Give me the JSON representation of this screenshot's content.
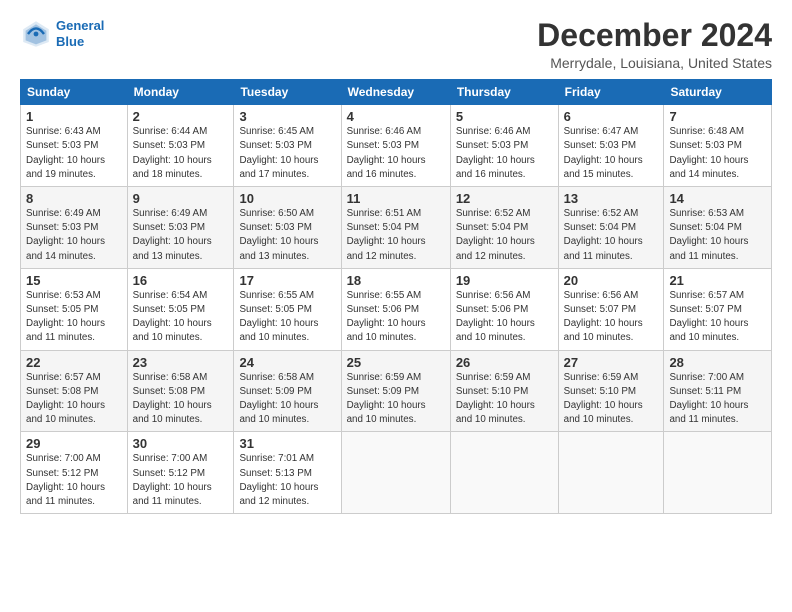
{
  "header": {
    "logo_line1": "General",
    "logo_line2": "Blue",
    "title": "December 2024",
    "subtitle": "Merrydale, Louisiana, United States"
  },
  "weekdays": [
    "Sunday",
    "Monday",
    "Tuesday",
    "Wednesday",
    "Thursday",
    "Friday",
    "Saturday"
  ],
  "weeks": [
    [
      {
        "day": "1",
        "info": "Sunrise: 6:43 AM\nSunset: 5:03 PM\nDaylight: 10 hours\nand 19 minutes."
      },
      {
        "day": "2",
        "info": "Sunrise: 6:44 AM\nSunset: 5:03 PM\nDaylight: 10 hours\nand 18 minutes."
      },
      {
        "day": "3",
        "info": "Sunrise: 6:45 AM\nSunset: 5:03 PM\nDaylight: 10 hours\nand 17 minutes."
      },
      {
        "day": "4",
        "info": "Sunrise: 6:46 AM\nSunset: 5:03 PM\nDaylight: 10 hours\nand 16 minutes."
      },
      {
        "day": "5",
        "info": "Sunrise: 6:46 AM\nSunset: 5:03 PM\nDaylight: 10 hours\nand 16 minutes."
      },
      {
        "day": "6",
        "info": "Sunrise: 6:47 AM\nSunset: 5:03 PM\nDaylight: 10 hours\nand 15 minutes."
      },
      {
        "day": "7",
        "info": "Sunrise: 6:48 AM\nSunset: 5:03 PM\nDaylight: 10 hours\nand 14 minutes."
      }
    ],
    [
      {
        "day": "8",
        "info": "Sunrise: 6:49 AM\nSunset: 5:03 PM\nDaylight: 10 hours\nand 14 minutes."
      },
      {
        "day": "9",
        "info": "Sunrise: 6:49 AM\nSunset: 5:03 PM\nDaylight: 10 hours\nand 13 minutes."
      },
      {
        "day": "10",
        "info": "Sunrise: 6:50 AM\nSunset: 5:03 PM\nDaylight: 10 hours\nand 13 minutes."
      },
      {
        "day": "11",
        "info": "Sunrise: 6:51 AM\nSunset: 5:04 PM\nDaylight: 10 hours\nand 12 minutes."
      },
      {
        "day": "12",
        "info": "Sunrise: 6:52 AM\nSunset: 5:04 PM\nDaylight: 10 hours\nand 12 minutes."
      },
      {
        "day": "13",
        "info": "Sunrise: 6:52 AM\nSunset: 5:04 PM\nDaylight: 10 hours\nand 11 minutes."
      },
      {
        "day": "14",
        "info": "Sunrise: 6:53 AM\nSunset: 5:04 PM\nDaylight: 10 hours\nand 11 minutes."
      }
    ],
    [
      {
        "day": "15",
        "info": "Sunrise: 6:53 AM\nSunset: 5:05 PM\nDaylight: 10 hours\nand 11 minutes."
      },
      {
        "day": "16",
        "info": "Sunrise: 6:54 AM\nSunset: 5:05 PM\nDaylight: 10 hours\nand 10 minutes."
      },
      {
        "day": "17",
        "info": "Sunrise: 6:55 AM\nSunset: 5:05 PM\nDaylight: 10 hours\nand 10 minutes."
      },
      {
        "day": "18",
        "info": "Sunrise: 6:55 AM\nSunset: 5:06 PM\nDaylight: 10 hours\nand 10 minutes."
      },
      {
        "day": "19",
        "info": "Sunrise: 6:56 AM\nSunset: 5:06 PM\nDaylight: 10 hours\nand 10 minutes."
      },
      {
        "day": "20",
        "info": "Sunrise: 6:56 AM\nSunset: 5:07 PM\nDaylight: 10 hours\nand 10 minutes."
      },
      {
        "day": "21",
        "info": "Sunrise: 6:57 AM\nSunset: 5:07 PM\nDaylight: 10 hours\nand 10 minutes."
      }
    ],
    [
      {
        "day": "22",
        "info": "Sunrise: 6:57 AM\nSunset: 5:08 PM\nDaylight: 10 hours\nand 10 minutes."
      },
      {
        "day": "23",
        "info": "Sunrise: 6:58 AM\nSunset: 5:08 PM\nDaylight: 10 hours\nand 10 minutes."
      },
      {
        "day": "24",
        "info": "Sunrise: 6:58 AM\nSunset: 5:09 PM\nDaylight: 10 hours\nand 10 minutes."
      },
      {
        "day": "25",
        "info": "Sunrise: 6:59 AM\nSunset: 5:09 PM\nDaylight: 10 hours\nand 10 minutes."
      },
      {
        "day": "26",
        "info": "Sunrise: 6:59 AM\nSunset: 5:10 PM\nDaylight: 10 hours\nand 10 minutes."
      },
      {
        "day": "27",
        "info": "Sunrise: 6:59 AM\nSunset: 5:10 PM\nDaylight: 10 hours\nand 10 minutes."
      },
      {
        "day": "28",
        "info": "Sunrise: 7:00 AM\nSunset: 5:11 PM\nDaylight: 10 hours\nand 11 minutes."
      }
    ],
    [
      {
        "day": "29",
        "info": "Sunrise: 7:00 AM\nSunset: 5:12 PM\nDaylight: 10 hours\nand 11 minutes."
      },
      {
        "day": "30",
        "info": "Sunrise: 7:00 AM\nSunset: 5:12 PM\nDaylight: 10 hours\nand 11 minutes."
      },
      {
        "day": "31",
        "info": "Sunrise: 7:01 AM\nSunset: 5:13 PM\nDaylight: 10 hours\nand 12 minutes."
      },
      {
        "day": "",
        "info": ""
      },
      {
        "day": "",
        "info": ""
      },
      {
        "day": "",
        "info": ""
      },
      {
        "day": "",
        "info": ""
      }
    ]
  ]
}
